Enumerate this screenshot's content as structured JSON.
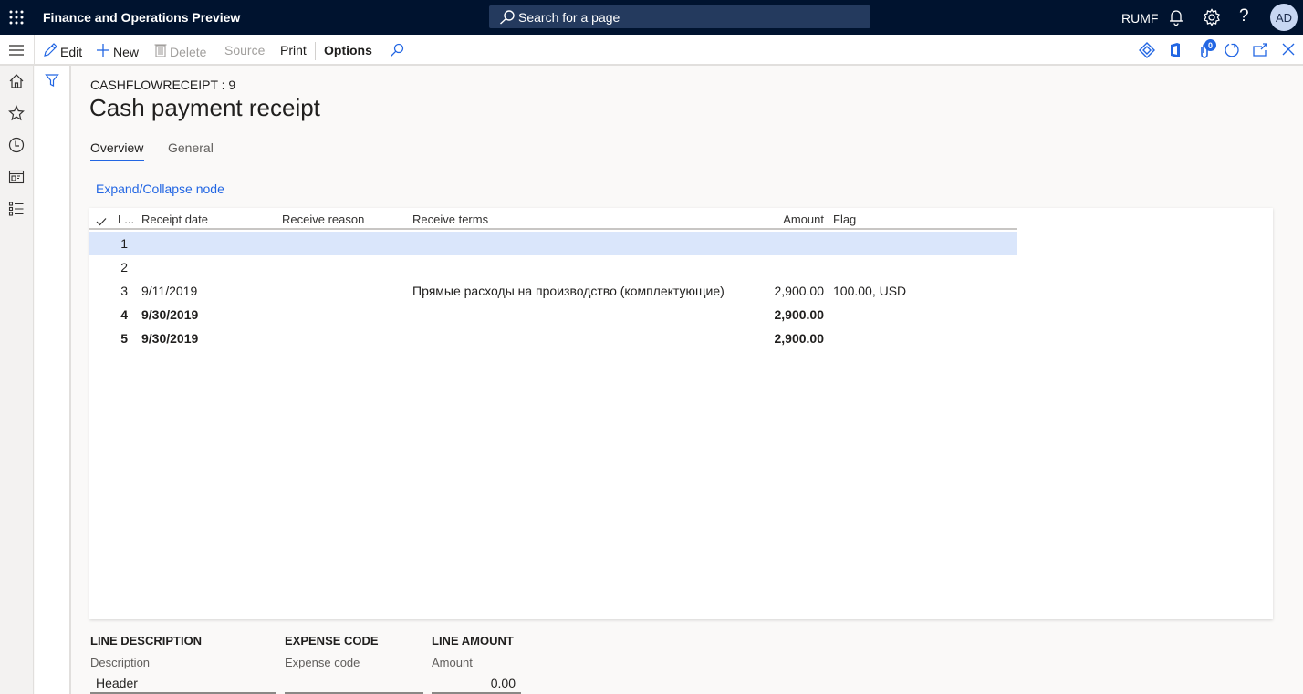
{
  "topbar": {
    "app_title": "Finance and Operations Preview",
    "search_placeholder": "Search for a page",
    "company": "RUMF",
    "avatar_initials": "AD",
    "icons": [
      "waffle-icon",
      "search-icon",
      "bell-icon",
      "gear-icon",
      "help-icon"
    ]
  },
  "actionbar": {
    "edit": "Edit",
    "new": "New",
    "delete": "Delete",
    "source": "Source",
    "print": "Print",
    "options": "Options",
    "attachments_count": "0",
    "right_icons": [
      "power-apps-icon",
      "office-icon",
      "attachment-icon",
      "refresh-icon",
      "open-new-window-icon",
      "close-icon"
    ]
  },
  "leftnav": {
    "items": [
      "menu-icon",
      "home-icon",
      "favorites-icon",
      "recent-icon",
      "workspaces-icon",
      "modules-icon"
    ]
  },
  "page": {
    "caption": "CASHFLOWRECEIPT : 9",
    "title": "Cash payment receipt",
    "tabs": [
      {
        "label": "Overview",
        "active": true
      },
      {
        "label": "General",
        "active": false
      }
    ],
    "expand_link": "Expand/Collapse node"
  },
  "grid": {
    "columns": [
      "L...",
      "Receipt date",
      "Receive reason",
      "Receive terms",
      "Amount",
      "Flag"
    ],
    "rows": [
      {
        "line": "1",
        "date": "",
        "reason": "",
        "terms": "",
        "amount": "",
        "flag": "",
        "bold": false,
        "selected": true
      },
      {
        "line": "2",
        "date": "",
        "reason": "",
        "terms": "",
        "amount": "",
        "flag": "",
        "bold": false,
        "selected": false
      },
      {
        "line": "3",
        "date": "9/11/2019",
        "reason": "",
        "terms": "Прямые расходы на производство (комплектующие)",
        "amount": "2,900.00",
        "flag": "100.00, USD",
        "bold": false,
        "selected": false
      },
      {
        "line": "4",
        "date": "9/30/2019",
        "reason": "",
        "terms": "",
        "amount": "2,900.00",
        "flag": "",
        "bold": true,
        "selected": false
      },
      {
        "line": "5",
        "date": "9/30/2019",
        "reason": "",
        "terms": "",
        "amount": "2,900.00",
        "flag": "",
        "bold": true,
        "selected": false
      }
    ]
  },
  "details": {
    "line_description": {
      "heading": "LINE DESCRIPTION",
      "label": "Description",
      "value": "Header"
    },
    "expense_code": {
      "heading": "EXPENSE CODE",
      "label": "Expense code",
      "value": ""
    },
    "line_amount": {
      "heading": "LINE AMOUNT",
      "label": "Amount",
      "value": "0.00"
    }
  },
  "colors": {
    "nav_bg": "#00132f",
    "accent": "#2266e3",
    "selected_row": "#dae6fb"
  }
}
